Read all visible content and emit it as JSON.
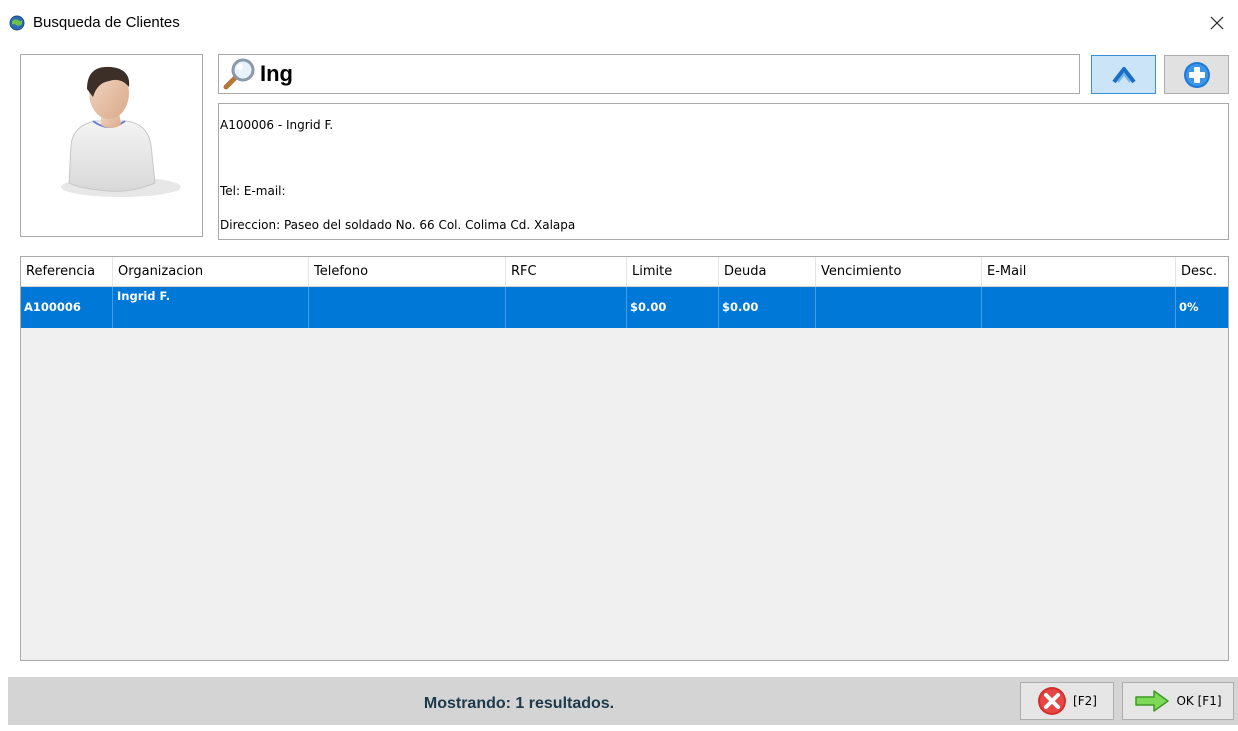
{
  "window": {
    "title": "Busqueda de Clientes"
  },
  "search": {
    "value": "Ing"
  },
  "info": {
    "line1": "A100006 - Ingrid F.",
    "line2": "Tel:  E-mail:",
    "line3": "Direccion: Paseo del soldado No. 66 Col. Colima Cd. Xalapa"
  },
  "table": {
    "columns": [
      "Referencia",
      "Organizacion",
      "Telefono",
      "RFC",
      "Limite",
      "Deuda",
      "Vencimiento",
      "E-Mail",
      "Desc."
    ],
    "rows": [
      [
        "A100006",
        "Ingrid F.",
        "",
        "",
        "$0.00",
        "$0.00",
        "",
        "",
        "0%"
      ]
    ]
  },
  "status": {
    "text": "Mostrando: 1 resultados."
  },
  "buttons": {
    "cancel_label": "[F2]",
    "ok_label": "OK [F1]"
  },
  "icons": {
    "app": "app-globe-icon",
    "close": "close-icon",
    "search": "magnifier-icon",
    "up": "chevron-up-icon",
    "add": "add-circle-icon",
    "cancel": "red-x-icon",
    "ok": "green-arrow-icon",
    "avatar": "user-avatar-icon"
  },
  "colors": {
    "selection": "#0078d7",
    "statusbar": "#d4d4d4",
    "status_text": "#1c3a4a"
  }
}
